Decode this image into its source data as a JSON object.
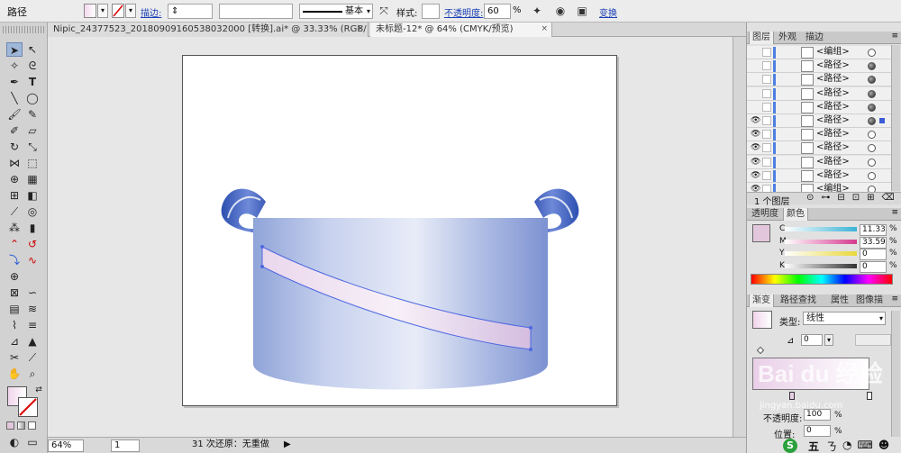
{
  "control_bar": {
    "object_type": "路径",
    "stroke_label": "描边:",
    "stroke_profile": "基本",
    "style_label": "样式:",
    "opacity_label": "不透明度:",
    "opacity_value": "60",
    "opacity_unit": "%",
    "transform_link": "变换"
  },
  "document_tabs": [
    {
      "label": "Nipic_24377523_20180909160538032000  [转换].ai* @ 33.33% (RGB/预览)",
      "close": "×"
    },
    {
      "label": "未标题-12* @ 64% (CMYK/预览)",
      "close": "×"
    }
  ],
  "status_bar": {
    "zoom": "64%",
    "artboard": "1",
    "status_text": "31 次还原：无重做"
  },
  "layers_panel": {
    "tabs": [
      "图层",
      "外观",
      "描边"
    ],
    "rows": [
      {
        "name": "<编组>",
        "eye": false,
        "target": "empty"
      },
      {
        "name": "<路径>",
        "eye": false,
        "target": "filled"
      },
      {
        "name": "<路径>",
        "eye": false,
        "target": "filled"
      },
      {
        "name": "<路径>",
        "eye": false,
        "target": "filled"
      },
      {
        "name": "<路径>",
        "eye": false,
        "target": "filled"
      },
      {
        "name": "<路径>",
        "eye": true,
        "target": "filled"
      },
      {
        "name": "<路径>",
        "eye": true,
        "target": "empty"
      },
      {
        "name": "<路径>",
        "eye": true,
        "target": "empty"
      },
      {
        "name": "<路径>",
        "eye": true,
        "target": "empty"
      },
      {
        "name": "<路径>",
        "eye": true,
        "target": "empty"
      },
      {
        "name": "<编组>",
        "eye": true,
        "target": "empty"
      }
    ],
    "footer": "1 个图层"
  },
  "color_panel": {
    "tabs": [
      "透明度",
      "颜色"
    ],
    "channels": [
      {
        "label": "C",
        "value": "11.33",
        "color": "#39b3d6"
      },
      {
        "label": "M",
        "value": "33.59",
        "color": "#d6398f"
      },
      {
        "label": "Y",
        "value": "0",
        "color": "#e8d83b"
      },
      {
        "label": "K",
        "value": "0",
        "color": "#333333"
      }
    ],
    "pct": "%",
    "swatch_color": "#e2c7dc"
  },
  "gradient_panel": {
    "tabs": [
      "渐变",
      "路径查找",
      "属性",
      "图像描"
    ],
    "type_label": "类型:",
    "type_value": "线性",
    "angle_value": "0",
    "opacity_label": "不透明度:",
    "opacity_value": "100",
    "location_label": "位置:",
    "location_value": "0",
    "pct": "%"
  },
  "watermark": {
    "text": "Bai du 经验",
    "sub": "jingyan.baidu.com"
  },
  "taskbar": {
    "ime": "五",
    "ime2": "ㄋ"
  }
}
